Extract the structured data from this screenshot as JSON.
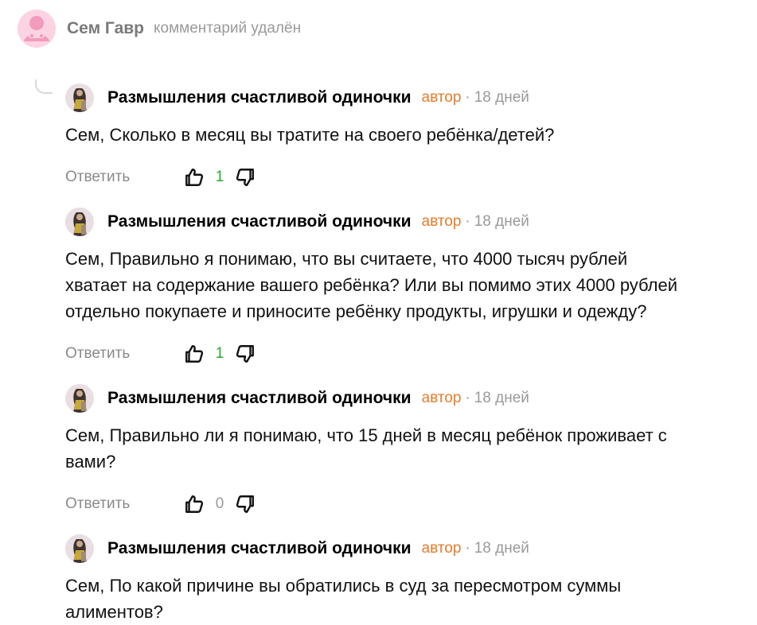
{
  "root": {
    "user": "Сем Гавр",
    "status": "комментарий удалён"
  },
  "replies": [
    {
      "author": "Размышления счастливой одиночки",
      "badge": "автор",
      "time": "18 дней",
      "lines": [
        "Сем, Сколько в месяц вы тратите на своего ребёнка/детей?"
      ],
      "reply_label": "Ответить",
      "likes": "1"
    },
    {
      "author": "Размышления счастливой одиночки",
      "badge": "автор",
      "time": "18 дней",
      "lines": [
        "Сем, Правильно я понимаю, что вы считаете, что 4000 тысяч рублей",
        "хватает на содержание вашего ребёнка? Или вы помимо этих 4000 рублей",
        "отдельно покупаете и приносите ребёнку продукты, игрушки и одежду?"
      ],
      "reply_label": "Ответить",
      "likes": "1"
    },
    {
      "author": "Размышления счастливой одиночки",
      "badge": "автор",
      "time": "18 дней",
      "lines": [
        "Сем, Правильно ли я понимаю, что 15 дней в месяц ребёнок проживает с",
        "вами?"
      ],
      "reply_label": "Ответить",
      "likes": "0"
    },
    {
      "author": "Размышления счастливой одиночки",
      "badge": "автор",
      "time": "18 дней",
      "lines": [
        "Сем, По какой причине вы обратились в суд за пересмотром суммы",
        "алиментов?"
      ]
    }
  ],
  "colors": {
    "author_badge": "#f07a2a",
    "positive_count": "#2ea836",
    "muted": "#9a9a9a",
    "root_avatar_bg": "#fbd3e3"
  },
  "icons": {
    "like": "thumbs-up-icon",
    "dislike": "thumbs-down-icon",
    "thread": "reply-thread-icon"
  }
}
